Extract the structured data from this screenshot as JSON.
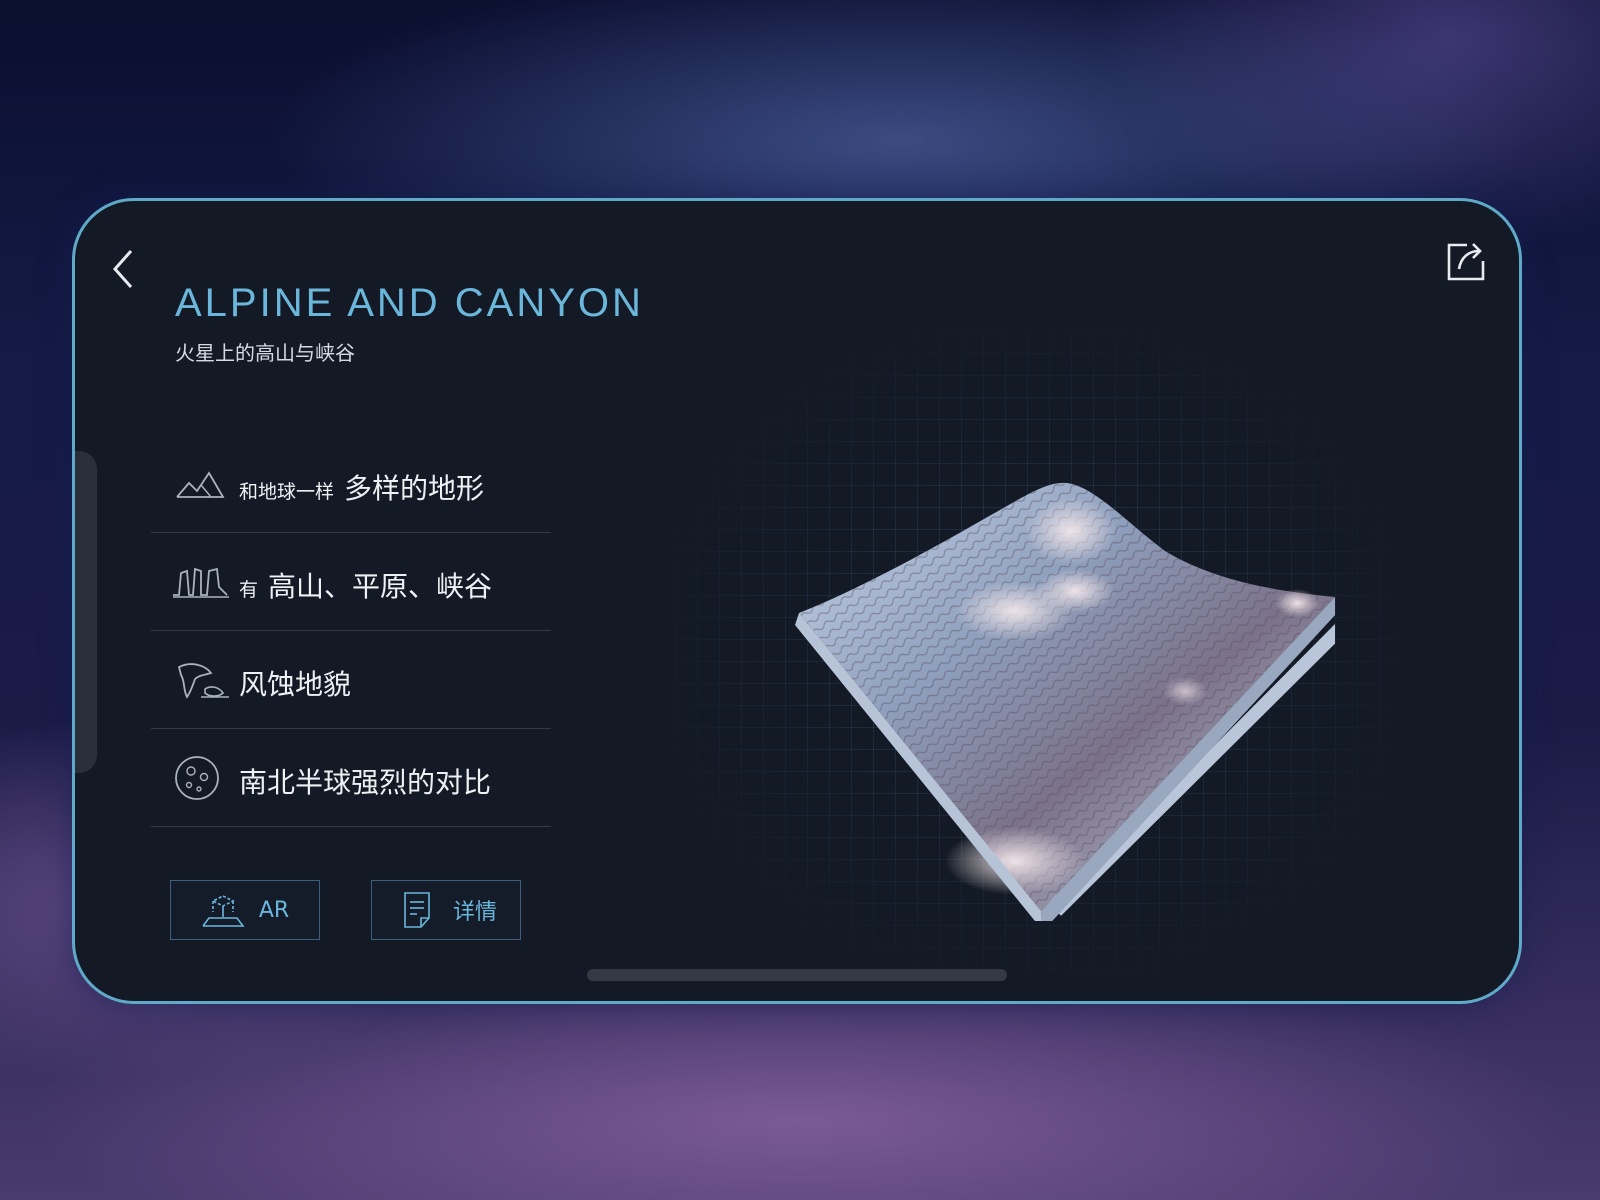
{
  "header": {
    "title": "ALPINE AND CANYON",
    "subtitle": "火星上的高山与峡谷"
  },
  "features": [
    {
      "icon": "mountain-icon",
      "prefix": "和地球一样",
      "text": "多样的地形"
    },
    {
      "icon": "canyon-icon",
      "prefix": "有",
      "text": "高山、平原、峡谷"
    },
    {
      "icon": "wind-erosion-icon",
      "prefix": "",
      "text": "风蚀地貌"
    },
    {
      "icon": "planet-crater-icon",
      "prefix": "",
      "text": "南北半球强烈的对比"
    }
  ],
  "actions": {
    "ar_label": "AR",
    "detail_label": "详情"
  },
  "colors": {
    "accent": "#6bb7dc",
    "frame": "#5fa9c9",
    "panel": "#141a25"
  }
}
